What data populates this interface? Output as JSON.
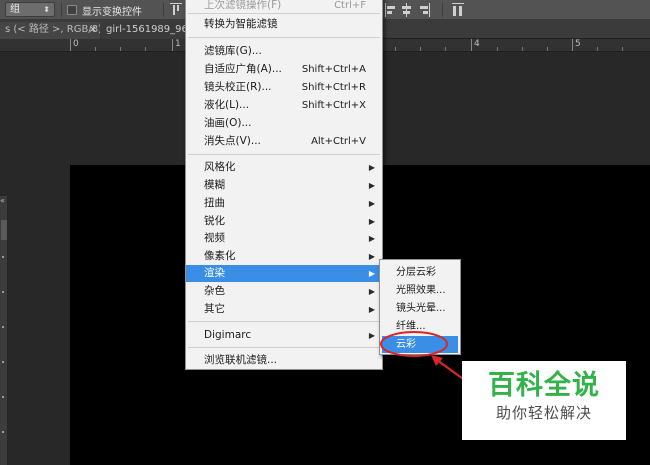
{
  "options_bar": {
    "group_select": "组",
    "show_transform_controls_label": "显示变换控件"
  },
  "tabs": [
    {
      "label": "s (< 路径 >, RGB/8)",
      "close": "×"
    },
    {
      "label": "girl-1561989_96",
      "close": "×"
    }
  ],
  "ruler": {
    "labels": [
      "0",
      "1",
      "4",
      "5"
    ]
  },
  "filter_menu": {
    "last_filter": {
      "label": "上次滤镜操作(F)",
      "shortcut": "Ctrl+F"
    },
    "convert_smart": "转换为智能滤镜",
    "gallery": "滤镜库(G)...",
    "adaptive_wide": {
      "label": "自适应广角(A)...",
      "shortcut": "Shift+Ctrl+A"
    },
    "lens_correction": {
      "label": "镜头校正(R)...",
      "shortcut": "Shift+Ctrl+R"
    },
    "liquify": {
      "label": "液化(L)...",
      "shortcut": "Shift+Ctrl+X"
    },
    "oil_paint": "油画(O)...",
    "vanishing_point": {
      "label": "消失点(V)...",
      "shortcut": "Alt+Ctrl+V"
    },
    "stylize": "风格化",
    "blur": "模糊",
    "distort": "扭曲",
    "sharpen": "锐化",
    "video": "视频",
    "pixelate": "像素化",
    "render": "渲染",
    "noise": "杂色",
    "other": "其它",
    "digimarc": "Digimarc",
    "browse_online": "浏览联机滤镜..."
  },
  "render_submenu": {
    "difference_clouds": "分层云彩",
    "lighting_effects": "光照效果...",
    "lens_flare": "镜头光晕...",
    "fibers": "纤维...",
    "clouds": "云彩"
  },
  "watermark": {
    "brand": "百科全说",
    "sub": "助你轻松解决"
  },
  "colors": {
    "menu_highlight": "#3a8ee6",
    "annotation_red": "#d9262b",
    "brand_green": "#33b24a"
  }
}
